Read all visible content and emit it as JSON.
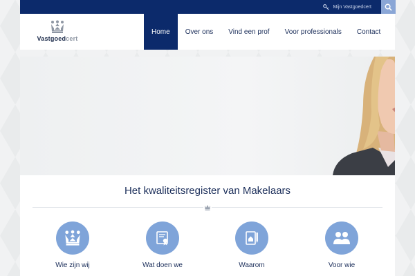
{
  "topbar": {
    "account_link": "Mijn Vastgoedcert"
  },
  "logo": {
    "text_main": "Vastgoed",
    "text_accent": "cert"
  },
  "nav": {
    "items": [
      {
        "label": "Home"
      },
      {
        "label": "Over ons"
      },
      {
        "label": "Vind een prof"
      },
      {
        "label": "Voor professionals"
      },
      {
        "label": "Contact"
      }
    ]
  },
  "main": {
    "headline": "Het kwaliteitsregister van Makelaars",
    "features": [
      {
        "label": "Wie zijn wij",
        "icon": "crown-icon"
      },
      {
        "label": "Wat doen we",
        "icon": "certificate-icon"
      },
      {
        "label": "Waarom",
        "icon": "document-pen-icon"
      },
      {
        "label": "Voor wie",
        "icon": "users-icon"
      }
    ]
  },
  "colors": {
    "navy": "#0c2a6b",
    "accent": "#7fa4d9",
    "search": "#8aa6d6"
  }
}
